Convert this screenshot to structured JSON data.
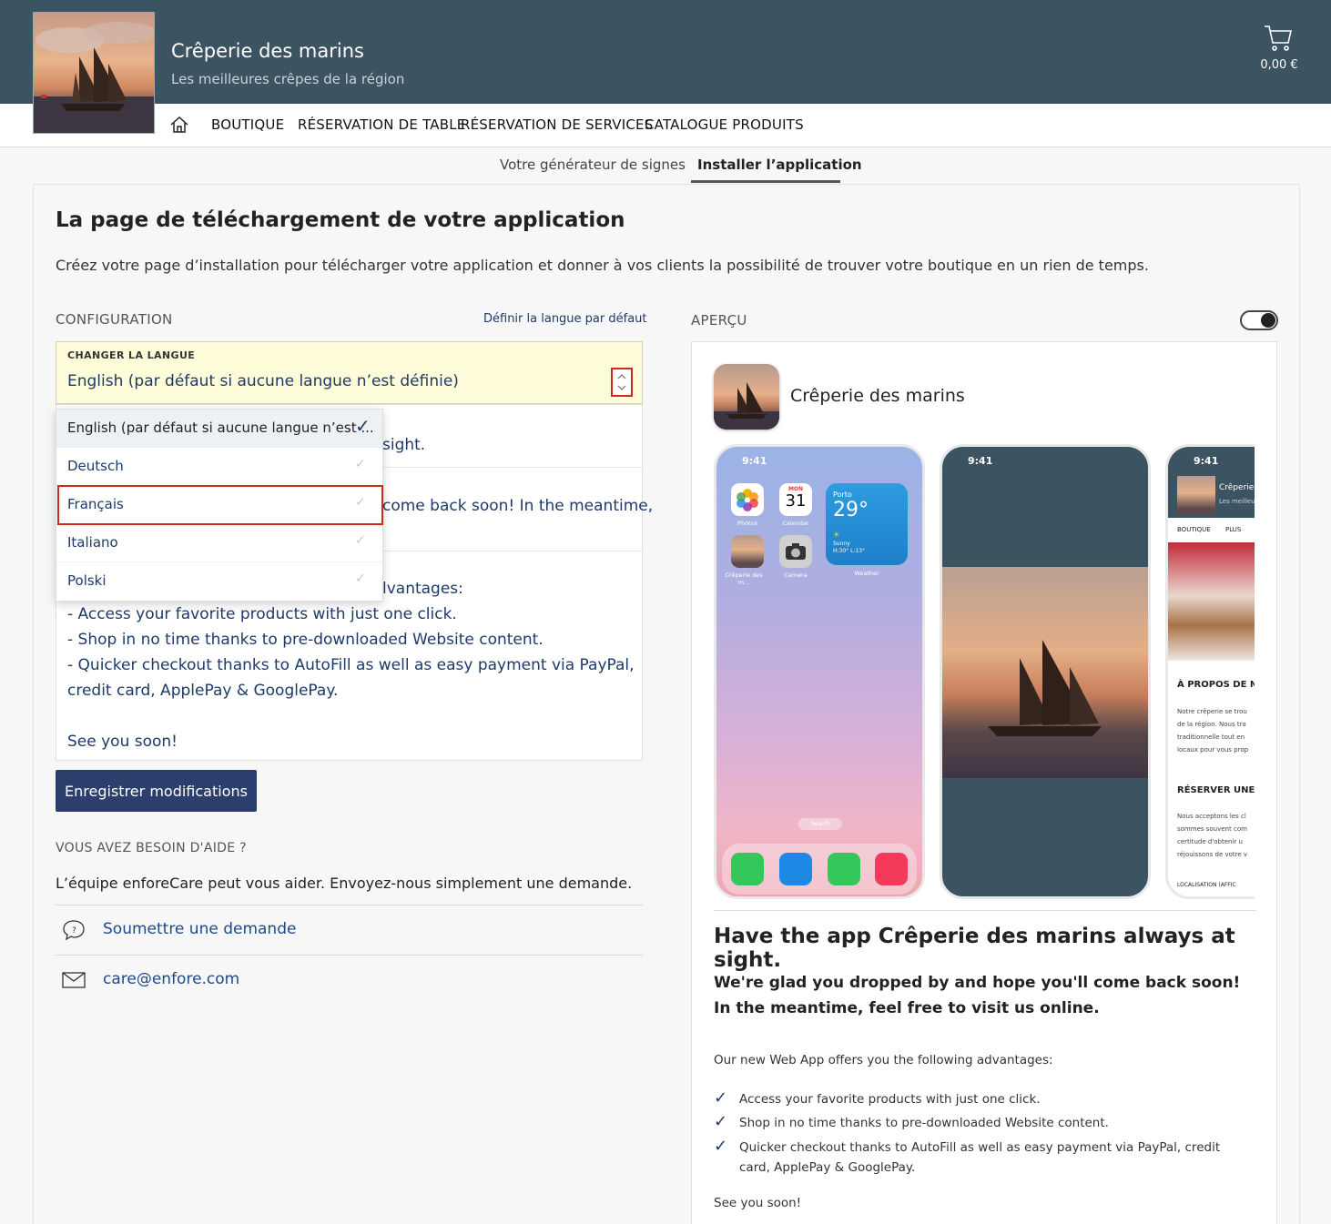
{
  "header": {
    "shop_title": "Crêperie des marins",
    "shop_subtitle": "Les meilleures crêpes de la région",
    "cart_total": "0,00 €"
  },
  "nav": {
    "items": [
      "BOUTIQUE",
      "RÉSERVATION DE TABLE",
      "RÉSERVATION DE SERVICES",
      "CATALOGUE PRODUITS"
    ]
  },
  "subnav": {
    "tab_generator": "Votre générateur de signes",
    "tab_install": "Installer l’application"
  },
  "page": {
    "heading": "La page de téléchargement de votre application",
    "description": "Créez votre page d’installation pour télécharger votre application et donner à vos clients la possibilité de trouver votre boutique en un rien de temps."
  },
  "config": {
    "label": "CONFIGURATION",
    "default_lang_link": "Définir la langue par défaut",
    "select_label": "CHANGER LA LANGUE",
    "select_value": "English (par défaut si aucune langue n’est définie)",
    "options": [
      "English (par défaut si aucune langue n’est ...",
      "Deutsch",
      "Français",
      "Italiano",
      "Polski"
    ],
    "text_fragments": {
      "line1": "sight.",
      "line2": "come back soon! In the meantime,",
      "line3": "lvantages:",
      "line4": "- Access your favorite products with just one click.",
      "line5": "- Shop in no time thanks to pre-downloaded Website content.",
      "line6": "- Quicker checkout thanks to AutoFill as well as easy payment via PayPal,",
      "line7": "credit card, ApplePay & GooglePay.",
      "line8": "See you soon!"
    },
    "save_button": "Enregistrer modifications"
  },
  "help": {
    "label": "VOUS AVEZ BESOIN D'AIDE ?",
    "text": "L’équipe enforeCare peut vous aider. Envoyez-nous simplement une demande.",
    "submit_link": "Soumettre une demande",
    "email_link": "care@enfore.com"
  },
  "preview": {
    "label": "APERÇU",
    "app_name": "Crêperie des marins",
    "phone_time": "9:41",
    "home_icons": {
      "photos": "Photos",
      "calendar": "Calendar",
      "calendar_month": "MON",
      "calendar_day": "31",
      "app": "Crêperie des m...",
      "camera": "Camera",
      "weather": "Weather",
      "weather_city": "Porto",
      "weather_temp": "29°",
      "weather_desc": "Sunny",
      "weather_range": "H:30° L:13°",
      "search": "Search"
    },
    "web_preview": {
      "title": "Crêperie c",
      "subtitle": "Les meilleu",
      "nav1": "BOUTIQUE",
      "nav2": "PLUS",
      "section1": "À PROPOS DE N",
      "text1a": "Notre crêperie se trou",
      "text1b": "de la région. Nous tra",
      "text1c": "traditionnelle tout en",
      "text1d": "locaux pour vous prop",
      "section2": "RÉSERVER UNE",
      "text2a": "Nous acceptons les cl",
      "text2b": "sommes souvent com",
      "text2c": "certitude d'obtenir u",
      "text2d": "réjouissons de votre v",
      "footer": "LOCALISATION (AFFIC"
    },
    "heading": "Have the app Crêperie des marins always at sight.",
    "subheading": "We're glad you dropped by and hope you'll come back soon! In the meantime, feel free to visit us online.",
    "intro": "Our new Web App offers you the following advantages:",
    "advantages": [
      "Access your favorite products with just one click.",
      "Shop in no time thanks to pre-downloaded Website content.",
      "Quicker checkout thanks to AutoFill as well as easy payment via PayPal, credit card, ApplePay & GooglePay."
    ],
    "closing": "See you soon!"
  },
  "colors": {
    "header_bg": "#3c5362",
    "accent": "#2c3e6b",
    "link": "#1e3a6a",
    "highlight": "#d0281c",
    "select_bg": "#fefcd9"
  }
}
